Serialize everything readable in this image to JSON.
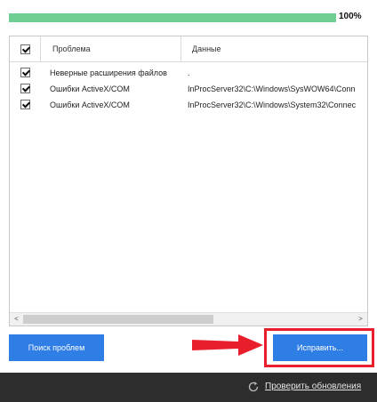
{
  "progress": {
    "percent": 100,
    "label": "100%"
  },
  "table": {
    "columns": {
      "problem": "Проблема",
      "data": "Данные"
    },
    "rows": [
      {
        "checked": true,
        "problem": "Неверные расширения файлов",
        "data": "."
      },
      {
        "checked": true,
        "problem": "Ошибки ActiveX/COM",
        "data": "InProcServer32\\C:\\Windows\\SysWOW64\\Conn"
      },
      {
        "checked": true,
        "problem": "Ошибки ActiveX/COM",
        "data": "InProcServer32\\C:\\Windows\\System32\\Connec"
      }
    ]
  },
  "scrollbar": {
    "left_arrow": "<",
    "right_arrow": ">"
  },
  "buttons": {
    "scan": "Поиск проблем",
    "fix": "Исправить..."
  },
  "footer": {
    "update_link": "Проверить обновления"
  },
  "colors": {
    "progress": "#6fce91",
    "button": "#2f7ee6",
    "highlight": "#e81f2b",
    "footer": "#2d2d2d"
  },
  "icons": {
    "refresh": "refresh-icon",
    "checkbox": "checkbox-checked-icon"
  }
}
